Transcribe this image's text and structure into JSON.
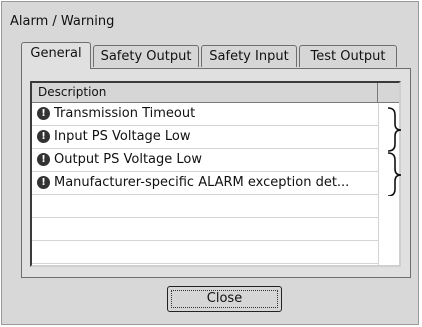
{
  "window": {
    "title": "Alarm / Warning"
  },
  "tabs": [
    {
      "label": "General",
      "active": true
    },
    {
      "label": "Safety Output",
      "active": false
    },
    {
      "label": "Safety Input",
      "active": false
    },
    {
      "label": "Test Output",
      "active": false
    }
  ],
  "list": {
    "column_header": "Description",
    "rows": [
      {
        "text": "Transmission Timeout",
        "icon": "alarm-icon"
      },
      {
        "text": "Input PS Voltage Low",
        "icon": "alarm-icon"
      },
      {
        "text": "Output PS Voltage Low",
        "icon": "alarm-icon"
      },
      {
        "text": "Manufacturer-specific ALARM exception det...",
        "icon": "alarm-icon"
      }
    ]
  },
  "buttons": {
    "close": "Close"
  }
}
